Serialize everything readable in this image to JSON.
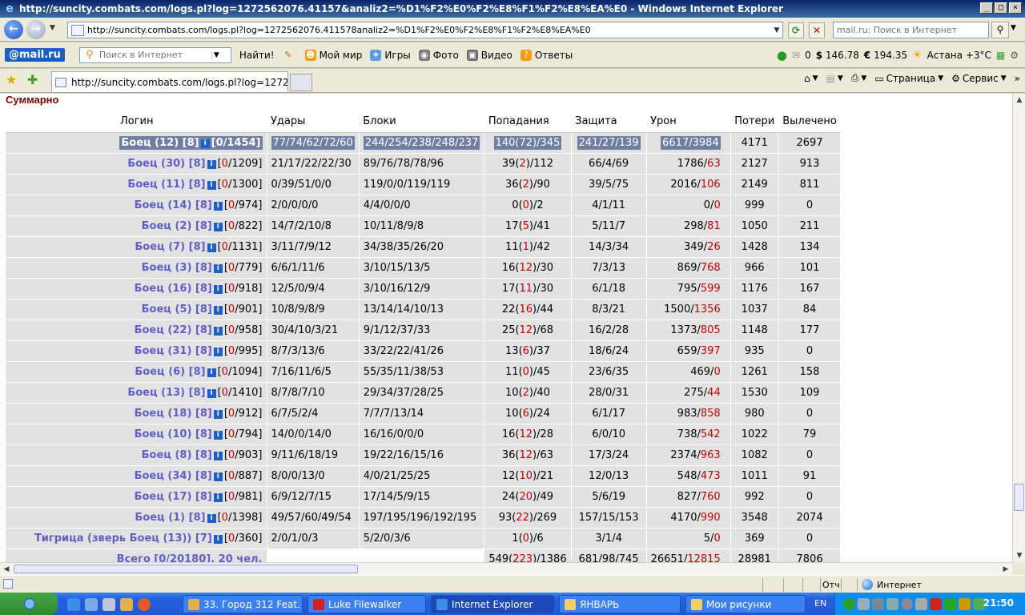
{
  "window": {
    "title": "http://suncity.combats.com/logs.pl?log=1272562076.41157&analiz2=%D1%F2%E0%F2%E8%F1%F2%E8%EA%E0 - Windows Internet Explorer"
  },
  "address": {
    "url": "http://suncity.combats.com/logs.pl?log=1272562076.411578analiz2=%D1%F2%E0%F2%E8%F1%F2%E8%EA%E0",
    "search_placeholder": "mail.ru: Поиск в Интернет"
  },
  "mailbar": {
    "logo": "@mail.ru",
    "search_placeholder": "Поиск в Интернет",
    "find_label": "Найти!",
    "buttons": [
      "Мой мир",
      "Игры",
      "Фото",
      "Видео",
      "Ответы"
    ],
    "mail_count": "0",
    "usd": "146.78",
    "eur": "194.35",
    "weather": "Астана +3°C"
  },
  "tabs": {
    "active_tab": "http://suncity.combats.com/logs.pl?log=1272562076....",
    "page_menu": "Страница",
    "service_menu": "Сервис"
  },
  "content": {
    "section_title": "Суммарно",
    "columns": [
      "Логин",
      "Удары",
      "Блоки",
      "Попадания",
      "Защита",
      "Урон",
      "Потери",
      "Вылечено"
    ],
    "rows": [
      {
        "name": "Боец (12) [8]",
        "hp": "0",
        "hpmax": "1454",
        "hits": "77/74/62/72/60",
        "blocks": "244/254/238/248/237",
        "hit_a": "140",
        "hit_b": "72",
        "hit_c": "345",
        "def": "241/27/139",
        "dmg_a": "6617",
        "dmg_b": "3984",
        "loss": "4171",
        "heal": "2697",
        "selected": true
      },
      {
        "name": "Боец (30) [8]",
        "hp": "0",
        "hpmax": "1209",
        "hits": "21/17/22/22/30",
        "blocks": "89/76/78/78/96",
        "hit_a": "39",
        "hit_b": "2",
        "hit_c": "112",
        "def": "66/4/69",
        "dmg_a": "1786",
        "dmg_b": "63",
        "loss": "2127",
        "heal": "913"
      },
      {
        "name": "Боец (11) [8]",
        "hp": "0",
        "hpmax": "1300",
        "hits": "0/39/51/0/0",
        "blocks": "119/0/0/119/119",
        "hit_a": "36",
        "hit_b": "2",
        "hit_c": "90",
        "def": "39/5/75",
        "dmg_a": "2016",
        "dmg_b": "106",
        "loss": "2149",
        "heal": "811"
      },
      {
        "name": "Боец (14) [8]",
        "hp": "0",
        "hpmax": "974",
        "hits": "2/0/0/0/0",
        "blocks": "4/4/0/0/0",
        "hit_a": "0",
        "hit_b": "0",
        "hit_c": "2",
        "def": "4/1/11",
        "dmg_a": "0",
        "dmg_b": "0",
        "loss": "999",
        "heal": "0"
      },
      {
        "name": "Боец (2) [8]",
        "hp": "0",
        "hpmax": "822",
        "hits": "14/7/2/10/8",
        "blocks": "10/11/8/9/8",
        "hit_a": "17",
        "hit_b": "5",
        "hit_c": "41",
        "def": "5/11/7",
        "dmg_a": "298",
        "dmg_b": "81",
        "loss": "1050",
        "heal": "211"
      },
      {
        "name": "Боец (7) [8]",
        "hp": "0",
        "hpmax": "1131",
        "hits": "3/11/7/9/12",
        "blocks": "34/38/35/26/20",
        "hit_a": "11",
        "hit_b": "1",
        "hit_c": "42",
        "def": "14/3/34",
        "dmg_a": "349",
        "dmg_b": "26",
        "loss": "1428",
        "heal": "134"
      },
      {
        "name": "Боец (3) [8]",
        "hp": "0",
        "hpmax": "779",
        "hits": "6/6/1/11/6",
        "blocks": "3/10/15/13/5",
        "hit_a": "16",
        "hit_b": "12",
        "hit_c": "30",
        "def": "7/3/13",
        "dmg_a": "869",
        "dmg_b": "768",
        "loss": "966",
        "heal": "101"
      },
      {
        "name": "Боец (16) [8]",
        "hp": "0",
        "hpmax": "918",
        "hits": "12/5/0/9/4",
        "blocks": "3/10/16/12/9",
        "hit_a": "17",
        "hit_b": "11",
        "hit_c": "30",
        "def": "6/1/18",
        "dmg_a": "795",
        "dmg_b": "599",
        "loss": "1176",
        "heal": "167"
      },
      {
        "name": "Боец (5) [8]",
        "hp": "0",
        "hpmax": "901",
        "hits": "10/8/9/8/9",
        "blocks": "13/14/14/10/13",
        "hit_a": "22",
        "hit_b": "16",
        "hit_c": "44",
        "def": "8/3/21",
        "dmg_a": "1500",
        "dmg_b": "1356",
        "loss": "1037",
        "heal": "84"
      },
      {
        "name": "Боец (22) [8]",
        "hp": "0",
        "hpmax": "958",
        "hits": "30/4/10/3/21",
        "blocks": "9/1/12/37/33",
        "hit_a": "25",
        "hit_b": "12",
        "hit_c": "68",
        "def": "16/2/28",
        "dmg_a": "1373",
        "dmg_b": "805",
        "loss": "1148",
        "heal": "177"
      },
      {
        "name": "Боец (31) [8]",
        "hp": "0",
        "hpmax": "995",
        "hits": "8/7/3/13/6",
        "blocks": "33/22/22/41/26",
        "hit_a": "13",
        "hit_b": "6",
        "hit_c": "37",
        "def": "18/6/24",
        "dmg_a": "659",
        "dmg_b": "397",
        "loss": "935",
        "heal": "0"
      },
      {
        "name": "Боец (6) [8]",
        "hp": "0",
        "hpmax": "1094",
        "hits": "7/16/11/6/5",
        "blocks": "55/35/11/38/53",
        "hit_a": "11",
        "hit_b": "0",
        "hit_c": "45",
        "def": "23/6/35",
        "dmg_a": "469",
        "dmg_b": "0",
        "loss": "1261",
        "heal": "158"
      },
      {
        "name": "Боец (13) [8]",
        "hp": "0",
        "hpmax": "1410",
        "hits": "8/7/8/7/10",
        "blocks": "29/34/37/28/25",
        "hit_a": "10",
        "hit_b": "2",
        "hit_c": "40",
        "def": "28/0/31",
        "dmg_a": "275",
        "dmg_b": "44",
        "loss": "1530",
        "heal": "109"
      },
      {
        "name": "Боец (18) [8]",
        "hp": "0",
        "hpmax": "912",
        "hits": "6/7/5/2/4",
        "blocks": "7/7/7/13/14",
        "hit_a": "10",
        "hit_b": "6",
        "hit_c": "24",
        "def": "6/1/17",
        "dmg_a": "983",
        "dmg_b": "858",
        "loss": "980",
        "heal": "0"
      },
      {
        "name": "Боец (10) [8]",
        "hp": "0",
        "hpmax": "794",
        "hits": "14/0/0/14/0",
        "blocks": "16/16/0/0/0",
        "hit_a": "16",
        "hit_b": "12",
        "hit_c": "28",
        "def": "6/0/10",
        "dmg_a": "738",
        "dmg_b": "542",
        "loss": "1022",
        "heal": "79"
      },
      {
        "name": "Боец (8) [8]",
        "hp": "0",
        "hpmax": "903",
        "hits": "9/11/6/18/19",
        "blocks": "19/22/16/15/16",
        "hit_a": "36",
        "hit_b": "12",
        "hit_c": "63",
        "def": "17/3/24",
        "dmg_a": "2374",
        "dmg_b": "963",
        "loss": "1082",
        "heal": "0"
      },
      {
        "name": "Боец (34) [8]",
        "hp": "0",
        "hpmax": "887",
        "hits": "8/0/0/13/0",
        "blocks": "4/0/21/25/25",
        "hit_a": "12",
        "hit_b": "10",
        "hit_c": "21",
        "def": "12/0/13",
        "dmg_a": "548",
        "dmg_b": "473",
        "loss": "1011",
        "heal": "91"
      },
      {
        "name": "Боец (17) [8]",
        "hp": "0",
        "hpmax": "981",
        "hits": "6/9/12/7/15",
        "blocks": "17/14/5/9/15",
        "hit_a": "24",
        "hit_b": "20",
        "hit_c": "49",
        "def": "5/6/19",
        "dmg_a": "827",
        "dmg_b": "760",
        "loss": "992",
        "heal": "0"
      },
      {
        "name": "Боец (1) [8]",
        "hp": "0",
        "hpmax": "1398",
        "hits": "49/57/60/49/54",
        "blocks": "197/195/196/192/195",
        "hit_a": "93",
        "hit_b": "22",
        "hit_c": "269",
        "def": "157/15/153",
        "dmg_a": "4170",
        "dmg_b": "990",
        "loss": "3548",
        "heal": "2074"
      },
      {
        "name": "Тигрица (зверь Боец (13)) [7]",
        "hp": "0",
        "hpmax": "360",
        "hits": "2/0/1/0/3",
        "blocks": "5/2/0/3/6",
        "hit_a": "1",
        "hit_b": "0",
        "hit_c": "6",
        "def": "3/1/4",
        "dmg_a": "5",
        "dmg_b": "0",
        "loss": "369",
        "heal": "0"
      }
    ],
    "total": {
      "label": "Всего [0/20180], 20 чел.",
      "hit_a": "549",
      "hit_b": "223",
      "hit_c": "1386",
      "def": "681/98/745",
      "dmg_a": "26651",
      "dmg_b": "12815",
      "loss": "28981",
      "heal": "7806"
    }
  },
  "status": {
    "otch": "Отч",
    "zone": "Интернет"
  },
  "taskbar": {
    "tasks": [
      "33. Город 312 Feat. ...",
      "Luke Filewalker",
      "Internet Explorer",
      "ЯНВАРЬ",
      "Мои рисунки"
    ],
    "lang": "EN",
    "clock": "21:50"
  }
}
